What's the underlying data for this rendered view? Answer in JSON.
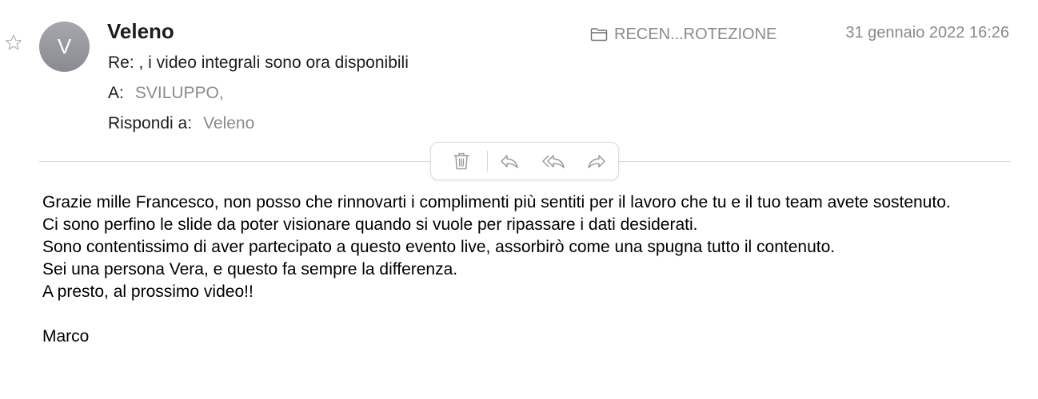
{
  "message": {
    "avatar_initial": "V",
    "sender": "Veleno",
    "subject": "Re: , i video integrali sono ora disponibili",
    "to_label": "A:",
    "to_value": "SVILUPPO,",
    "reply_to_label": "Rispondi a:",
    "reply_to_value": "Veleno",
    "mailbox": "RECEN...ROTEZIONE",
    "datetime": "31 gennaio 2022 16:26",
    "body_lines": [
      "Grazie mille Francesco, non posso che rinnovarti i complimenti più sentiti per il lavoro che tu e il tuo team avete sostenuto.",
      "Ci sono perfino le slide da poter visionare quando si vuole per ripassare i dati desiderati.",
      "Sono contentissimo di aver partecipato a questo evento live, assorbirò come una spugna tutto il contenuto.",
      "Sei una persona Vera, e questo fa sempre la differenza.",
      "A presto, al prossimo video!!"
    ],
    "signature": "Marco"
  },
  "toolbar": {
    "icons": [
      "trash-icon",
      "reply-icon",
      "reply-all-icon",
      "forward-icon"
    ]
  },
  "colors": {
    "secondary_text": "#8a8a8e",
    "icon_gray": "#9a9a9e",
    "avatar_bg": "#9a9aa1"
  }
}
